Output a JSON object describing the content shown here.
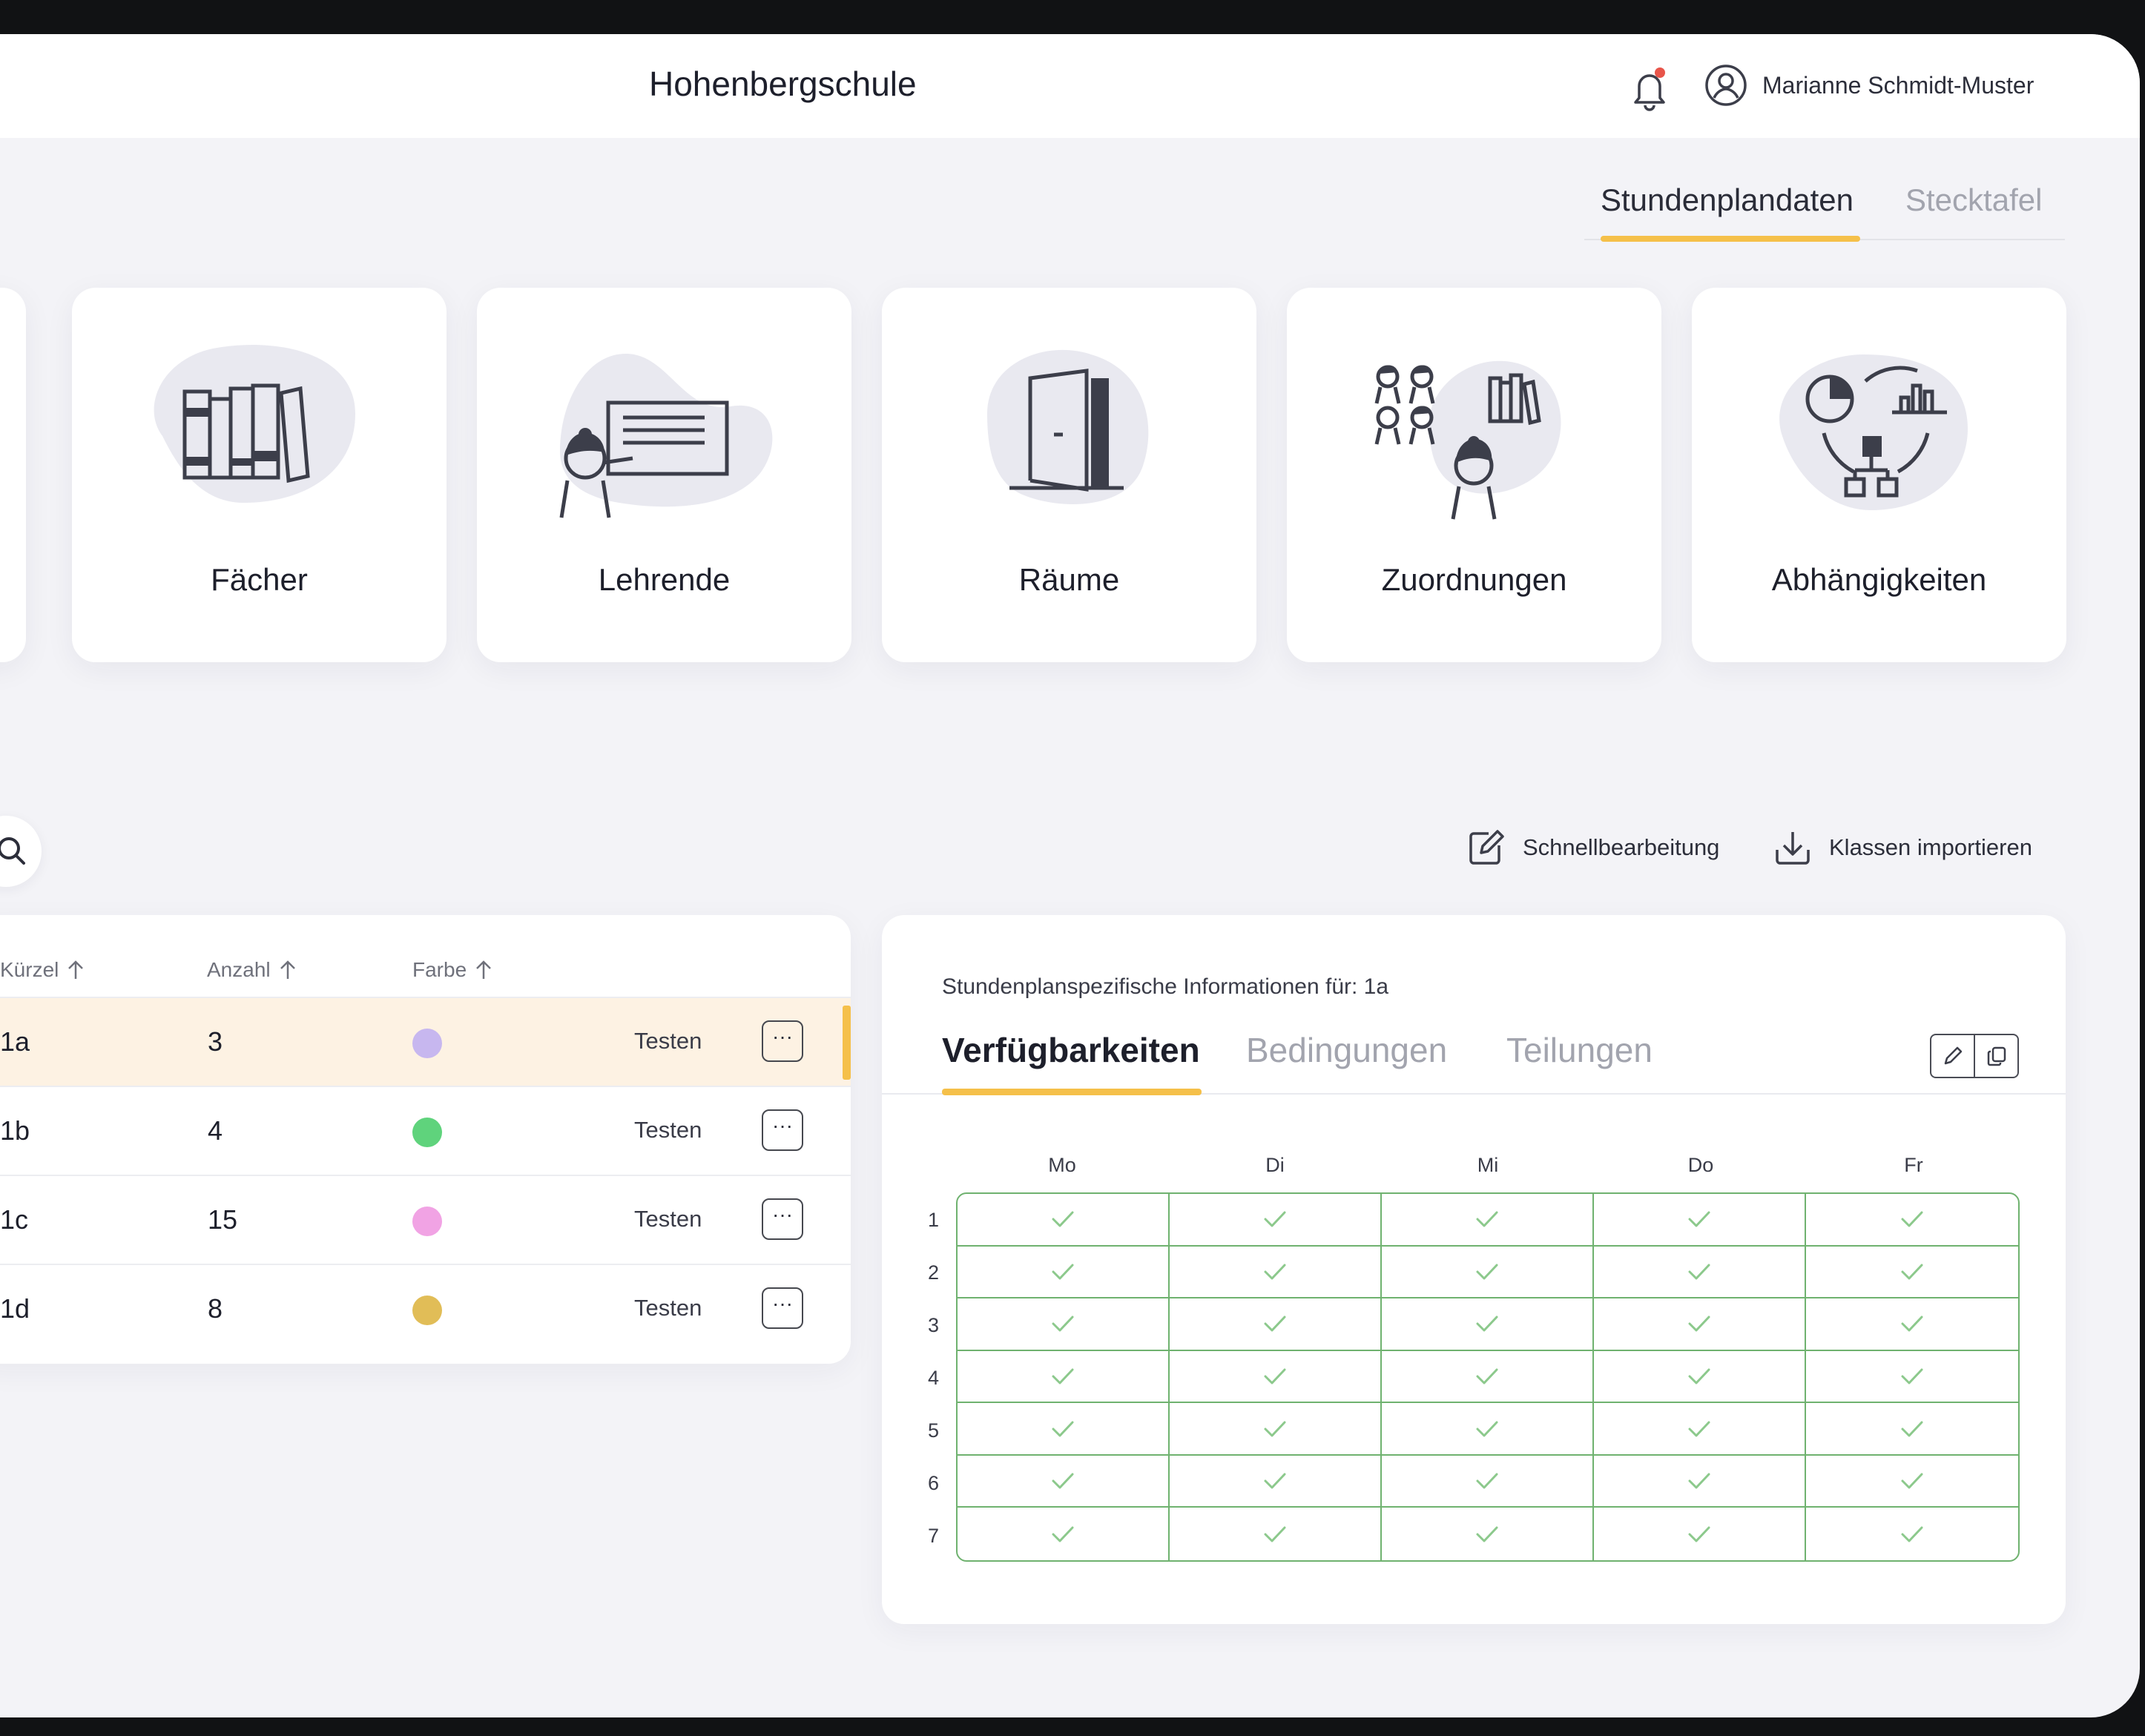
{
  "header": {
    "school_name": "Hohenbergschule",
    "user_name": "Marianne Schmidt-Muster",
    "notification_dot_color": "#e8554a"
  },
  "view_tabs": [
    {
      "label": "Stundenplandaten",
      "active": true
    },
    {
      "label": "Stecktafel",
      "active": false
    }
  ],
  "cards": [
    {
      "label": "Fächer",
      "icon": "books-icon"
    },
    {
      "label": "Lehrende",
      "icon": "teacher-board-icon"
    },
    {
      "label": "Räume",
      "icon": "door-icon"
    },
    {
      "label": "Zuordnungen",
      "icon": "assignment-icon"
    },
    {
      "label": "Abhängigkeiten",
      "icon": "dependencies-icon"
    }
  ],
  "toolbar": {
    "quick_edit_label": "Schnellbearbeitung",
    "import_label": "Klassen importieren"
  },
  "table": {
    "columns": [
      "Kürzel",
      "Anzahl",
      "Farbe"
    ],
    "rows": [
      {
        "code": "1a",
        "count": "3",
        "color": "#c7b7ef",
        "action": "Testen",
        "more": "···",
        "selected": true
      },
      {
        "code": "1b",
        "count": "4",
        "color": "#5fd37c",
        "action": "Testen",
        "more": "···",
        "selected": false
      },
      {
        "code": "1c",
        "count": "15",
        "color": "#f1a3e4",
        "action": "Testen",
        "more": "···",
        "selected": false
      },
      {
        "code": "1d",
        "count": "8",
        "color": "#e1bd57",
        "action": "Testen",
        "more": "···",
        "selected": false
      }
    ]
  },
  "detail": {
    "title": "Stundenplanspezifische Informationen für: 1a",
    "tabs": [
      {
        "label": "Verfügbarkeiten",
        "active": true
      },
      {
        "label": "Bedingungen",
        "active": false
      },
      {
        "label": "Teilungen",
        "active": false
      }
    ],
    "days": [
      "Mo",
      "Di",
      "Mi",
      "Do",
      "Fr"
    ],
    "periods": [
      "1",
      "2",
      "3",
      "4",
      "5",
      "6",
      "7"
    ],
    "all_available": true
  },
  "colors": {
    "accent": "#f5c04a",
    "grid_green": "#6fb26f",
    "illustration_blob": "#e9e9f0",
    "icon_stroke": "#3c3e4a"
  }
}
